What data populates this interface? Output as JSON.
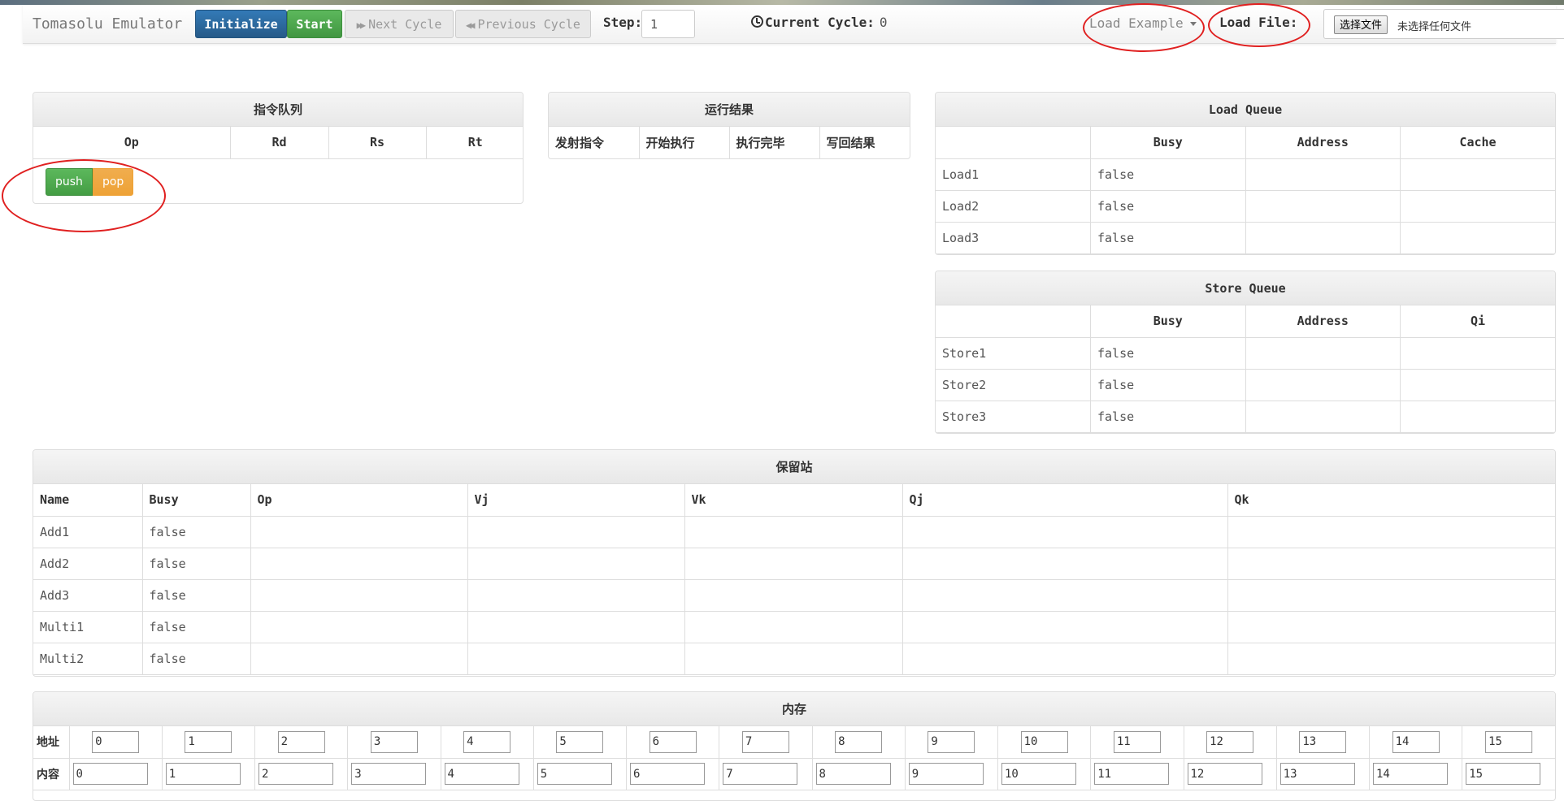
{
  "navbar": {
    "brand": "Tomasolu Emulator",
    "initialize_label": "Initialize",
    "start_label": "Start",
    "next_label": "Next Cycle",
    "prev_label": "Previous Cycle",
    "step_label": "Step:",
    "step_value": "1",
    "cycle_label": "Current Cycle:",
    "cycle_value": "0",
    "load_example_label": "Load Example",
    "load_file_label": "Load File:",
    "file_button_label": "选择文件",
    "file_status": "未选择任何文件"
  },
  "instruction_queue": {
    "title": "指令队列",
    "headers": [
      "Op",
      "Rd",
      "Rs",
      "Rt"
    ],
    "push_label": "push",
    "pop_label": "pop"
  },
  "run_results": {
    "title": "运行结果",
    "headers": [
      "发射指令",
      "开始执行",
      "执行完毕",
      "写回结果"
    ]
  },
  "load_queue": {
    "title": "Load Queue",
    "headers": [
      "",
      "Busy",
      "Address",
      "Cache"
    ],
    "rows": [
      {
        "name": "Load1",
        "busy": "false",
        "address": "",
        "cache": ""
      },
      {
        "name": "Load2",
        "busy": "false",
        "address": "",
        "cache": ""
      },
      {
        "name": "Load3",
        "busy": "false",
        "address": "",
        "cache": ""
      }
    ]
  },
  "store_queue": {
    "title": "Store Queue",
    "headers": [
      "",
      "Busy",
      "Address",
      "Qi"
    ],
    "rows": [
      {
        "name": "Store1",
        "busy": "false",
        "address": "",
        "qi": ""
      },
      {
        "name": "Store2",
        "busy": "false",
        "address": "",
        "qi": ""
      },
      {
        "name": "Store3",
        "busy": "false",
        "address": "",
        "qi": ""
      }
    ]
  },
  "reservation_station": {
    "title": "保留站",
    "headers": [
      "Name",
      "Busy",
      "Op",
      "Vj",
      "Vk",
      "Qj",
      "Qk"
    ],
    "rows": [
      {
        "name": "Add1",
        "busy": "false",
        "op": "",
        "vj": "",
        "vk": "",
        "qj": "",
        "qk": ""
      },
      {
        "name": "Add2",
        "busy": "false",
        "op": "",
        "vj": "",
        "vk": "",
        "qj": "",
        "qk": ""
      },
      {
        "name": "Add3",
        "busy": "false",
        "op": "",
        "vj": "",
        "vk": "",
        "qj": "",
        "qk": ""
      },
      {
        "name": "Multi1",
        "busy": "false",
        "op": "",
        "vj": "",
        "vk": "",
        "qj": "",
        "qk": ""
      },
      {
        "name": "Multi2",
        "busy": "false",
        "op": "",
        "vj": "",
        "vk": "",
        "qj": "",
        "qk": ""
      }
    ]
  },
  "memory": {
    "title": "内存",
    "address_label": "地址",
    "content_label": "内容",
    "addresses": [
      "0",
      "1",
      "2",
      "3",
      "4",
      "5",
      "6",
      "7",
      "8",
      "9",
      "10",
      "11",
      "12",
      "13",
      "14",
      "15"
    ],
    "contents": [
      "0",
      "1",
      "2",
      "3",
      "4",
      "5",
      "6",
      "7",
      "8",
      "9",
      "10",
      "11",
      "12",
      "13",
      "14",
      "15"
    ]
  },
  "colors": {
    "primary": "#2e6da4",
    "success": "#4cae4c",
    "warning": "#f0ad4e",
    "annotation": "#e02020"
  },
  "icons": {
    "next": "fast-forward-icon",
    "prev": "fast-backward-icon",
    "cycle": "clock-icon",
    "dropdown": "caret-down-icon"
  }
}
